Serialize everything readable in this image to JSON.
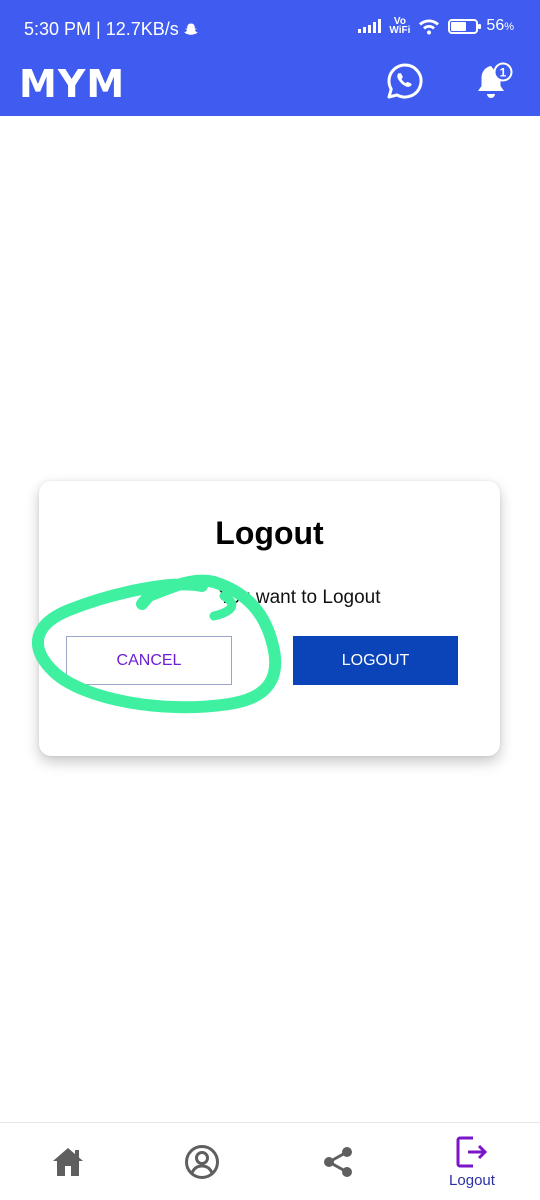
{
  "status_bar": {
    "time_speed": "5:30 PM | 12.7KB/s",
    "network_badge_top": "Vo",
    "network_badge_bottom": "WiFi",
    "battery_percent": "56",
    "battery_suffix": "%",
    "battery_level": 0.56
  },
  "app_bar": {
    "title": "MYM",
    "notification_count": "1",
    "icons": [
      "whatsapp-icon",
      "bell-icon"
    ]
  },
  "dialog": {
    "title": "Logout",
    "message": "You want to Logout",
    "cancel_label": "CANCEL",
    "confirm_label": "LOGOUT"
  },
  "bottom_nav": {
    "items": [
      {
        "icon": "home-icon",
        "label": ""
      },
      {
        "icon": "profile-icon",
        "label": ""
      },
      {
        "icon": "share-icon",
        "label": ""
      },
      {
        "icon": "logout-icon",
        "label": "Logout"
      }
    ]
  },
  "colors": {
    "app_bar": "#3f5bf0",
    "confirm_button": "#0b43b8",
    "cancel_text": "#6b1fd6",
    "annotation": "#3ef0a0",
    "nav_active": "#7a16c9"
  }
}
